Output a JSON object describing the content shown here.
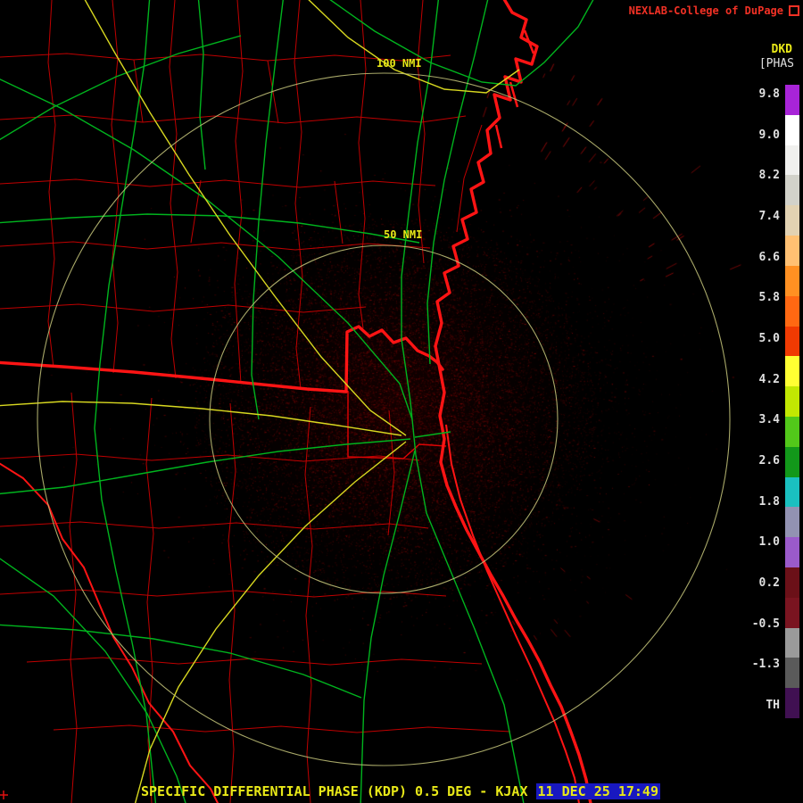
{
  "header": {
    "brand": "NEXLAB-College of DuPage",
    "brand_color": "#f23125",
    "product_code": "DKD",
    "product_code_color": "#e8e818",
    "units_label": "[PHAS",
    "units_color": "#e0e0e0"
  },
  "colorbar": {
    "labels": [
      "9.8",
      "9.0",
      "8.2",
      "7.4",
      "6.6",
      "5.8",
      "5.0",
      "4.2",
      "3.4",
      "2.6",
      "1.8",
      "1.0",
      "0.2",
      "-0.5",
      "-1.3",
      "TH"
    ],
    "segments": [
      "#a824d8",
      "#ffffff",
      "#f0f0ee",
      "#d2d2ca",
      "#e2d2b2",
      "#ffc072",
      "#ff9022",
      "#ff6812",
      "#f03a02",
      "#ffff32",
      "#c2e802",
      "#52c81a",
      "#12981a",
      "#1ac0c0",
      "#9292b2",
      "#9a5aca",
      "#6b1018",
      "#7a1420",
      "#9a9a9a",
      "#5a5a5a",
      "#401052"
    ],
    "label_color": "#e8e8e8"
  },
  "map": {
    "range_rings": [
      {
        "label": "100 NMI"
      },
      {
        "label": "50 NMI"
      }
    ],
    "label_color": "#e8e818",
    "ring_color": "#c0c078",
    "county_color": "#c00000",
    "border_color": "#ff1414",
    "highway_green": "#00b41e",
    "highway_yellow": "#d8d820",
    "echo_colors": [
      "#5c0000",
      "#780404",
      "#920808",
      "#6b0000"
    ]
  },
  "statusbar": {
    "product_text": "SPECIFIC DIFFERENTIAL PHASE (KDP) 0.5 DEG - KJAX",
    "timestamp": "11 DEC 25 17:49",
    "text_color": "#e8e818",
    "timestamp_bg": "#1818c0"
  }
}
